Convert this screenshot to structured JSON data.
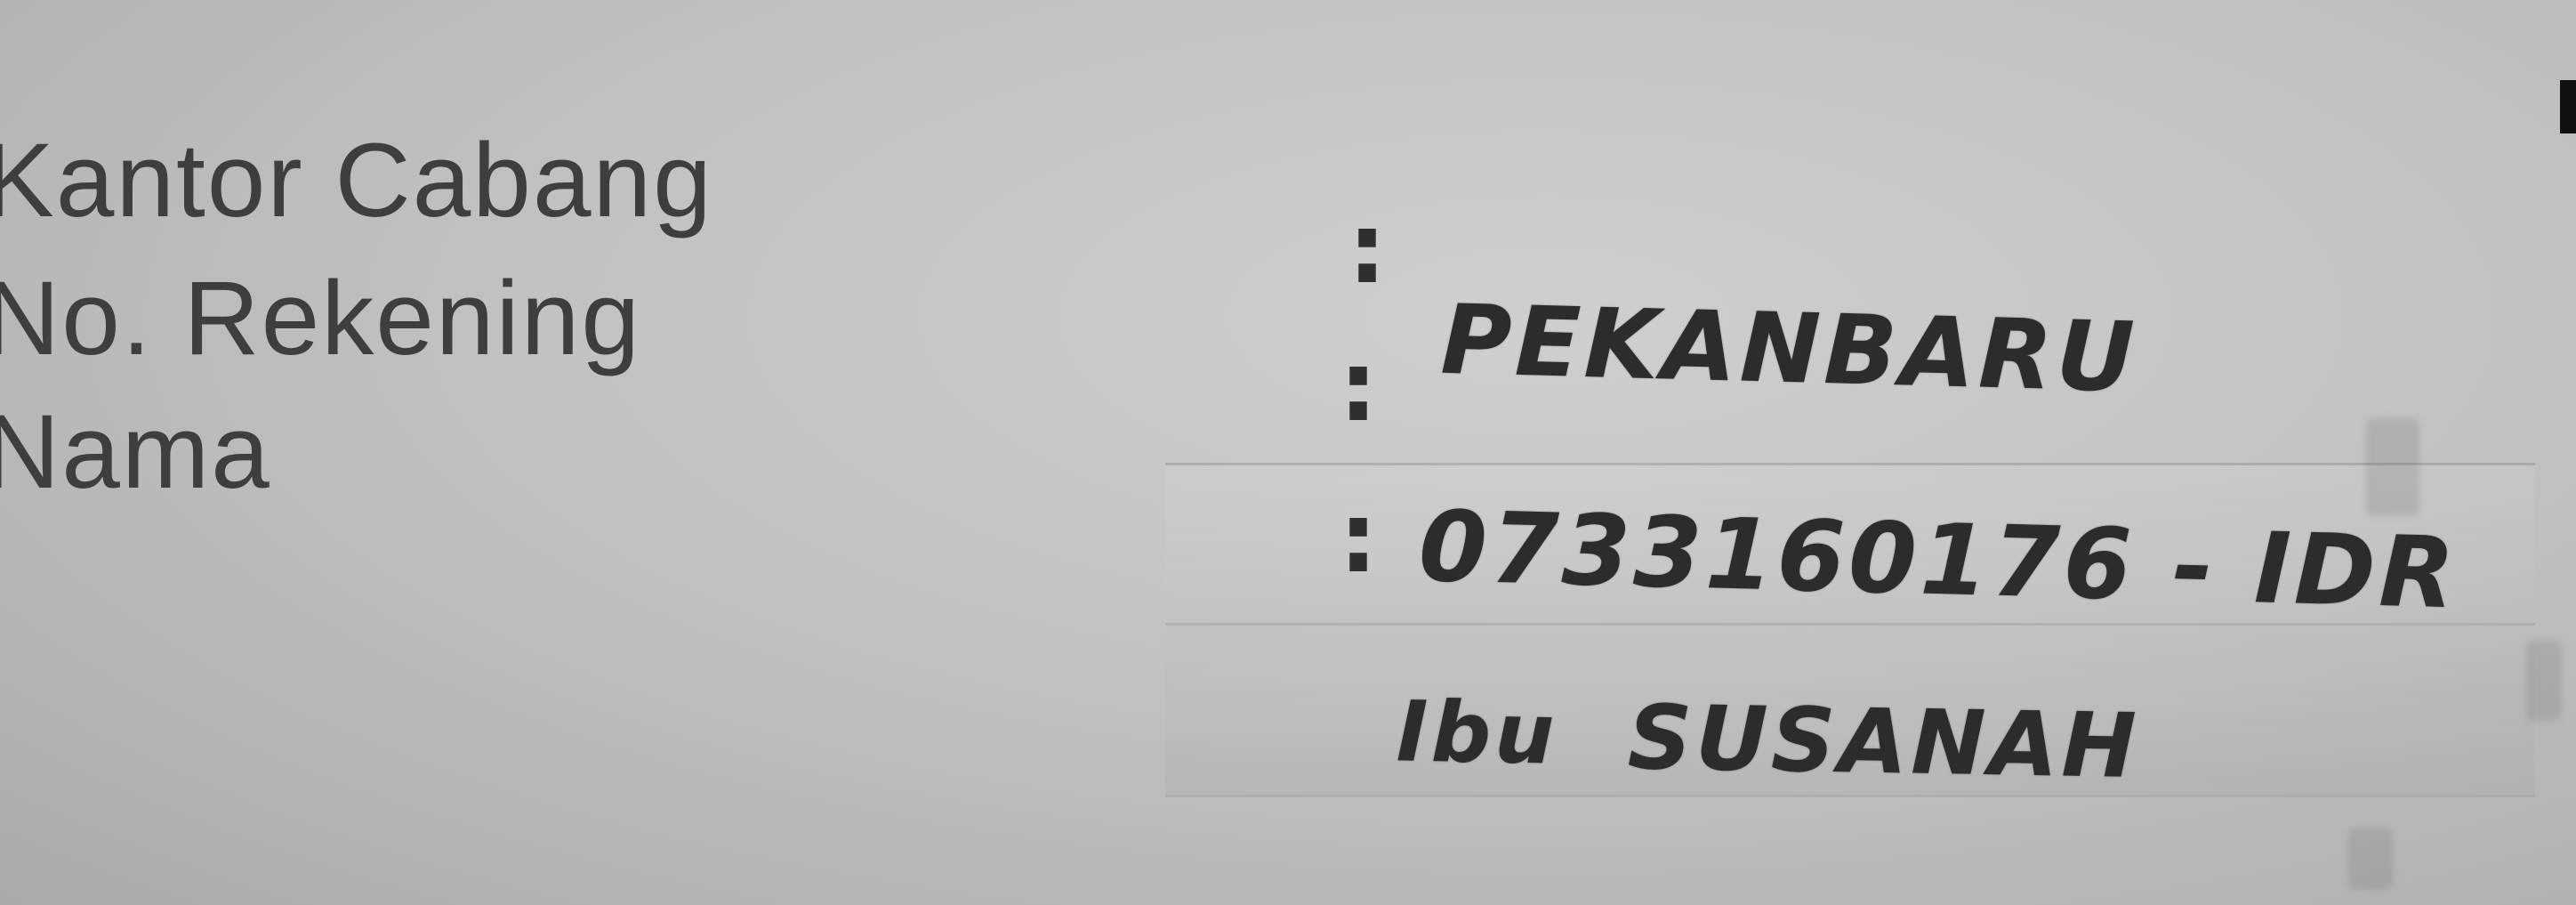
{
  "labels": {
    "branch": "Kantor Cabang",
    "account_number": "No. Rekening",
    "name": "Nama"
  },
  "separator": ":",
  "values": {
    "branch": "PEKANBARU",
    "account_number": "0733160176 - IDR",
    "name_prefix": "Ibu",
    "name": "SUSANAH"
  }
}
